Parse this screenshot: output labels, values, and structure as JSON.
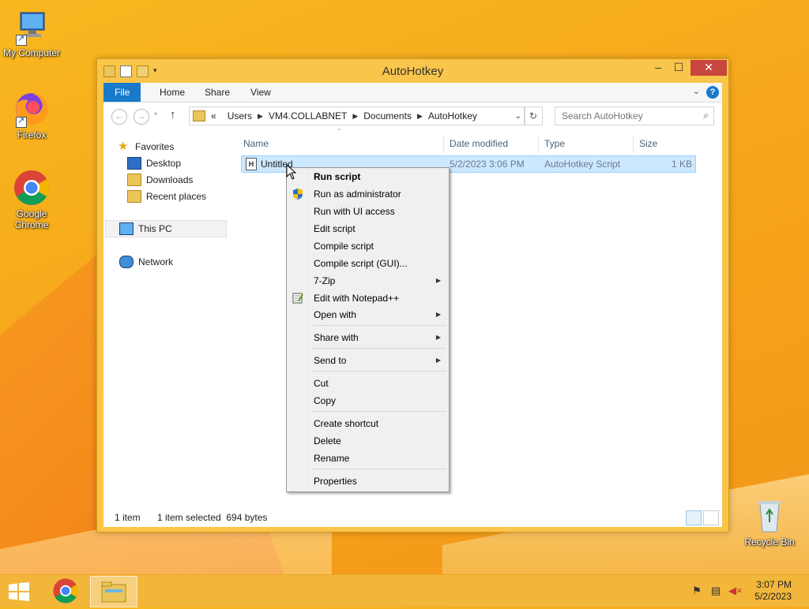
{
  "desktop": {
    "icons": [
      {
        "label": "My Computer"
      },
      {
        "label": "Firefox"
      },
      {
        "label": "Google Chrome"
      },
      {
        "label": "Recycle Bin"
      }
    ]
  },
  "window": {
    "title": "AutoHotkey",
    "ribbon_tabs": [
      "File",
      "Home",
      "Share",
      "View"
    ],
    "help_label": "?",
    "address": {
      "prefix": "«",
      "crumbs": [
        "Users",
        "VM4.COLLABNET",
        "Documents",
        "AutoHotkey"
      ]
    },
    "search_placeholder": "Search AutoHotkey",
    "nav": {
      "favorites": "Favorites",
      "desktop": "Desktop",
      "downloads": "Downloads",
      "recent": "Recent places",
      "this_pc": "This PC",
      "network": "Network"
    },
    "columns": [
      "Name",
      "Date modified",
      "Type",
      "Size"
    ],
    "files": [
      {
        "name": "Untitled",
        "date": "5/2/2023 3:06 PM",
        "type": "AutoHotkey Script",
        "size": "1 KB",
        "icon_letter": "H"
      }
    ],
    "status": {
      "count": "1 item",
      "selected": "1 item selected  694 bytes"
    }
  },
  "context_menu": {
    "items": [
      "Run script",
      "Run as administrator",
      "Run with UI access",
      "Edit script",
      "Compile script",
      "Compile script (GUI)...",
      "7-Zip",
      "Edit with Notepad++",
      "Open with",
      "Share with",
      "Send to",
      "Cut",
      "Copy",
      "Create shortcut",
      "Delete",
      "Rename",
      "Properties"
    ]
  },
  "taskbar": {
    "time": "3:07 PM",
    "date": "5/2/2023"
  },
  "colors": {
    "accent": "#1979ca",
    "selection": "#cce8ff",
    "close": "#c7463e",
    "frame": "#f9c54a"
  }
}
